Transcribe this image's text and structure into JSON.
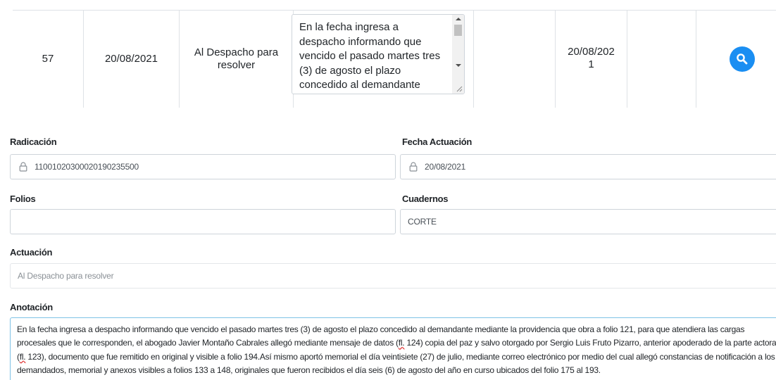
{
  "table_row": {
    "number": "57",
    "date": "20/08/2021",
    "actuacion": "Al Despacho para resolver",
    "anotacion_preview": "En la fecha ingresa a despacho informando que vencido el pasado martes tres (3) de agosto el plazo concedido al demandante",
    "col5": "",
    "registro_date": "20/08/2021",
    "col7": "",
    "action_icon": "search-icon"
  },
  "form": {
    "radicacion": {
      "label": "Radicación",
      "value": "11001020300020190235500",
      "icon": "lock-icon"
    },
    "fecha_actuacion": {
      "label": "Fecha Actuación",
      "value": "20/08/2021",
      "icon": "lock-icon"
    },
    "folios": {
      "label": "Folios",
      "value": ""
    },
    "cuadernos": {
      "label": "Cuadernos",
      "value": "CORTE"
    },
    "actuacion": {
      "label": "Actuación",
      "value": "Al Despacho para resolver"
    },
    "anotacion": {
      "label": "Anotación",
      "part1": "En la fecha ingresa a despacho informando que vencido el pasado martes tres (3) de agosto el plazo concedido al demandante mediante la providencia que obra a folio 121, para que atendiera las cargas procesales que le corresponden, el abogado Javier Montaño Cabrales allegó mediante mensaje de datos (",
      "fl1": "fl.",
      "part2": " 124) copia del paz y salvo otorgado por Sergio Luis Fruto Pizarro, anterior apoderado de la parte actora (",
      "fl2": "fl.",
      "part3": " 123), documento que fue remitido en original y visible a folio 194.Así mismo aportó memorial el día veintisiete (27) de julio, mediante correo electrónico por medio del cual allegó constancias de notificación a los demandados, memorial y anexos visibles a folios 133 a 148, originales que fueron recibidos el día seis (6) de agosto del año en curso ubicados del folio 175 al 193."
    }
  },
  "colors": {
    "accent": "#1a8ef2",
    "border": "#ced4da",
    "focus_border": "#7ec2e6"
  }
}
